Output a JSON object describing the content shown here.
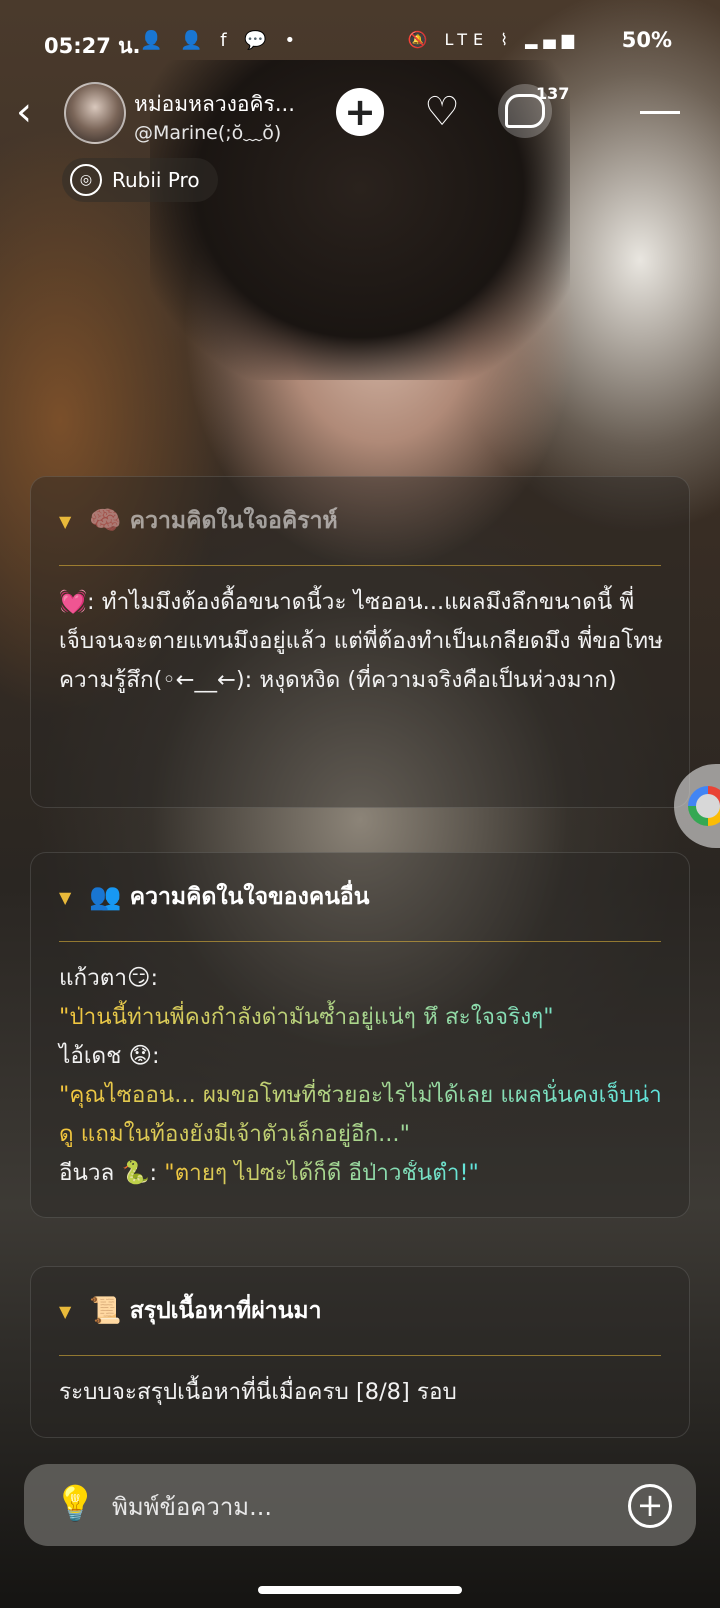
{
  "status_bar": {
    "time": "05:27 น.",
    "notification_icons": "👤 👤 f 💬 •",
    "system_icons": "🔕 LTE ⌇ ▂▄▆",
    "battery": "50%"
  },
  "header": {
    "character_name": "หม่อมหลวงอคิร...",
    "handle": "@Marine(;ŏ﹏ŏ)",
    "chat_count": "137",
    "rubii_label": "Rubii Pro"
  },
  "cards": {
    "inner_thoughts": {
      "title": "ความคิดในใจอคิราห์",
      "emoji": "🧠",
      "line1_emoji": "💓",
      "line1": ": ทำไมมึงต้องดื้อขนาดนี้วะ ไซออน...แผลมึงลึกขนาดนี้ พี่เจ็บจนจะตายแทนมึงอยู่แล้ว แต่พี่ต้องทำเป็นเกลียดมึง พี่ขอโทษ",
      "line2": "ความรู้สึก(◦←__←): หงุดหงิด (ที่ความจริงคือเป็นห่วงมาก)"
    },
    "others_thoughts": {
      "title": "ความคิดในใจของคนอื่น",
      "emoji": "👥",
      "p1_name": "แก้วตา😏:",
      "p1_quote": "\"ป่านนี้ท่านพี่คงกำลังด่ามันซ้ำอยู่แน่ๆ หึ สะใจจริงๆ\"",
      "p2_name": "ไอ้เดช 😟:",
      "p2_quote": "\"คุณไซออน... ผมขอโทษที่ช่วยอะไรไม่ได้เลย แผลนั่นคงเจ็บน่าดู แถมในท้องยังมีเจ้าตัวเล็กอยู่อีก...\"",
      "p3_name": "อีนวล 🐍: ",
      "p3_quote": "\"ตายๆ ไปซะได้ก็ดี อีป่าวชั้นต่ำ!\""
    },
    "summary": {
      "title": "สรุปเนื้อหาที่ผ่านมา",
      "emoji": "📜",
      "text": "ระบบจะสรุปเนื้อหาที่นี่เมื่อครบ [8/8] รอบ"
    }
  },
  "input": {
    "placeholder": "พิมพ์ข้อความ..."
  },
  "colors": {
    "accent_yellow": "#f4c53b",
    "accent_cyan": "#5ee6e0"
  }
}
